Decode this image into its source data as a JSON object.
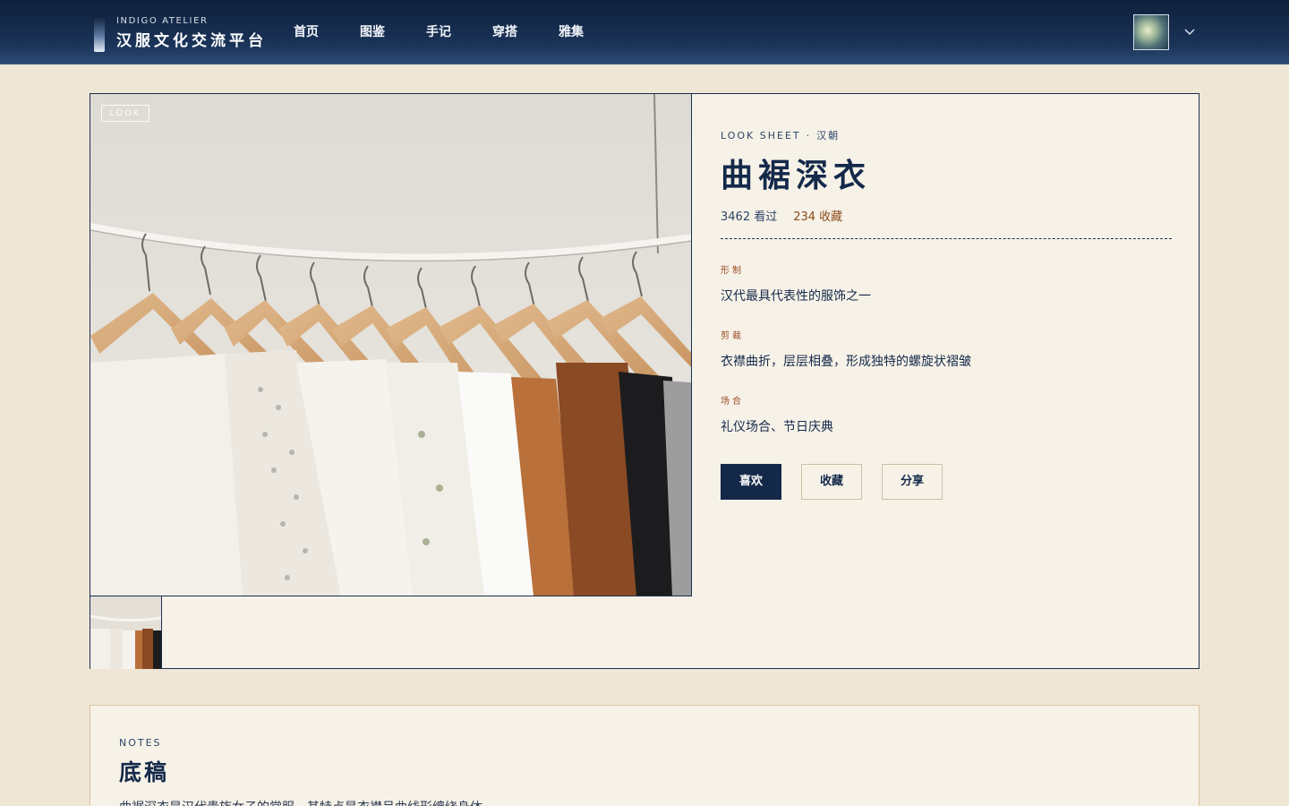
{
  "header": {
    "brand_en": "INDIGO ATELIER",
    "brand_cn": "汉服文化交流平台",
    "nav": [
      {
        "label": "首页"
      },
      {
        "label": "图鉴"
      },
      {
        "label": "手记"
      },
      {
        "label": "穿搭"
      },
      {
        "label": "雅集"
      }
    ]
  },
  "look": {
    "image_tag": "LOOK",
    "eyebrow": "LOOK SHEET",
    "dynasty": "汉朝",
    "title": "曲裾深衣",
    "views": "3462 看过",
    "favorites": "234 收藏",
    "fields": [
      {
        "label": "形制",
        "value": "汉代最具代表性的服饰之一"
      },
      {
        "label": "剪裁",
        "value": "衣襟曲折，层层相叠，形成独特的螺旋状褶皱"
      },
      {
        "label": "场合",
        "value": "礼仪场合、节日庆典"
      }
    ],
    "actions": {
      "like": "喜欢",
      "collect": "收藏",
      "share": "分享"
    }
  },
  "notes": {
    "eyebrow": "NOTES",
    "title": "底稿",
    "body": "曲裾深衣是汉代贵族女子的常服，其特点是衣襟呈曲线形缠绕身体"
  },
  "colors": {
    "navy": "#14294a",
    "cream": "#f7f2e8",
    "page_bg": "#efe6d6",
    "accent_rust": "#9a4c24"
  }
}
